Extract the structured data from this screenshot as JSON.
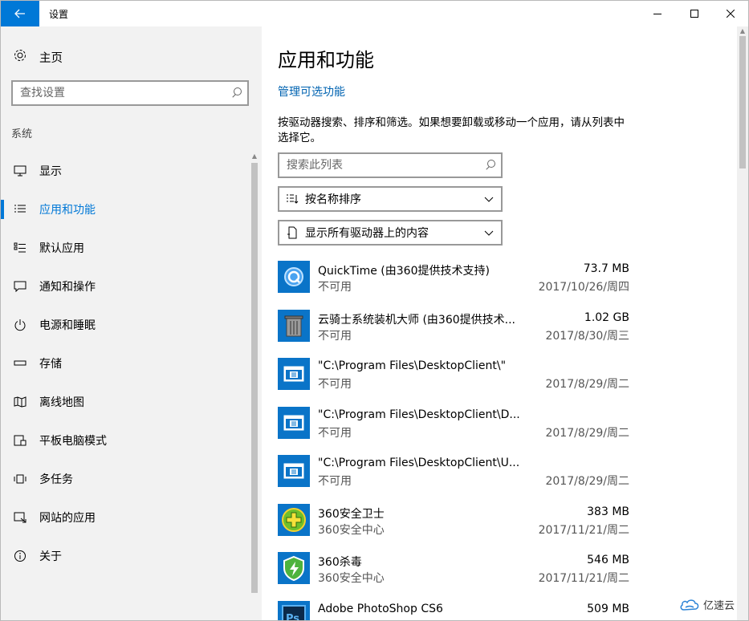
{
  "window": {
    "title": "设置"
  },
  "sidebar": {
    "home_label": "主页",
    "search_placeholder": "查找设置",
    "section_label": "系统",
    "items": [
      {
        "label": "显示",
        "icon": "monitor-icon",
        "active": false
      },
      {
        "label": "应用和功能",
        "icon": "list-icon",
        "active": true
      },
      {
        "label": "默认应用",
        "icon": "default-apps-icon",
        "active": false
      },
      {
        "label": "通知和操作",
        "icon": "notification-icon",
        "active": false
      },
      {
        "label": "电源和睡眠",
        "icon": "power-icon",
        "active": false
      },
      {
        "label": "存储",
        "icon": "storage-icon",
        "active": false
      },
      {
        "label": "离线地图",
        "icon": "map-icon",
        "active": false
      },
      {
        "label": "平板电脑模式",
        "icon": "tablet-icon",
        "active": false
      },
      {
        "label": "多任务",
        "icon": "multitask-icon",
        "active": false
      },
      {
        "label": "网站的应用",
        "icon": "web-apps-icon",
        "active": false
      },
      {
        "label": "关于",
        "icon": "info-icon",
        "active": false
      }
    ]
  },
  "main": {
    "title": "应用和功能",
    "manage_link": "管理可选功能",
    "description": "按驱动器搜索、排序和筛选。如果想要卸载或移动一个应用，请从列表中选择它。",
    "search_placeholder": "搜索此列表",
    "sort_label": "按名称排序",
    "filter_label": "显示所有驱动器上的内容",
    "apps": [
      {
        "name": "QuickTime (由360提供技术支持)",
        "sub": "不可用",
        "size": "73.7 MB",
        "date": "2017/10/26/周四",
        "icon": "quicktime-icon"
      },
      {
        "name": "云骑士系统装机大师 (由360提供技术...",
        "sub": "不可用",
        "size": "1.02 GB",
        "date": "2017/8/30/周三",
        "icon": "trash-icon"
      },
      {
        "name": "\"C:\\Program Files\\DesktopClient\\\"",
        "sub": "不可用",
        "size": "",
        "date": "2017/8/29/周二",
        "icon": "program-icon"
      },
      {
        "name": "\"C:\\Program Files\\DesktopClient\\D...",
        "sub": "不可用",
        "size": "",
        "date": "2017/8/29/周二",
        "icon": "program-icon"
      },
      {
        "name": "\"C:\\Program Files\\DesktopClient\\U...",
        "sub": "不可用",
        "size": "",
        "date": "2017/8/29/周二",
        "icon": "program-icon"
      },
      {
        "name": "360安全卫士",
        "sub": "360安全中心",
        "size": "383 MB",
        "date": "2017/11/21/周二",
        "icon": "360-safe-icon"
      },
      {
        "name": "360杀毒",
        "sub": "360安全中心",
        "size": "546 MB",
        "date": "2017/11/21/周二",
        "icon": "360-antivirus-icon"
      },
      {
        "name": "Adobe PhotoShop CS6",
        "sub": "",
        "size": "509 MB",
        "date": "",
        "icon": "photoshop-icon"
      }
    ]
  },
  "watermark": {
    "text": "亿速云"
  },
  "colors": {
    "accent": "#0078d7",
    "link": "#0063b1",
    "sidebar_bg": "#f2f2f2",
    "app_tile": "#0a74c8"
  }
}
